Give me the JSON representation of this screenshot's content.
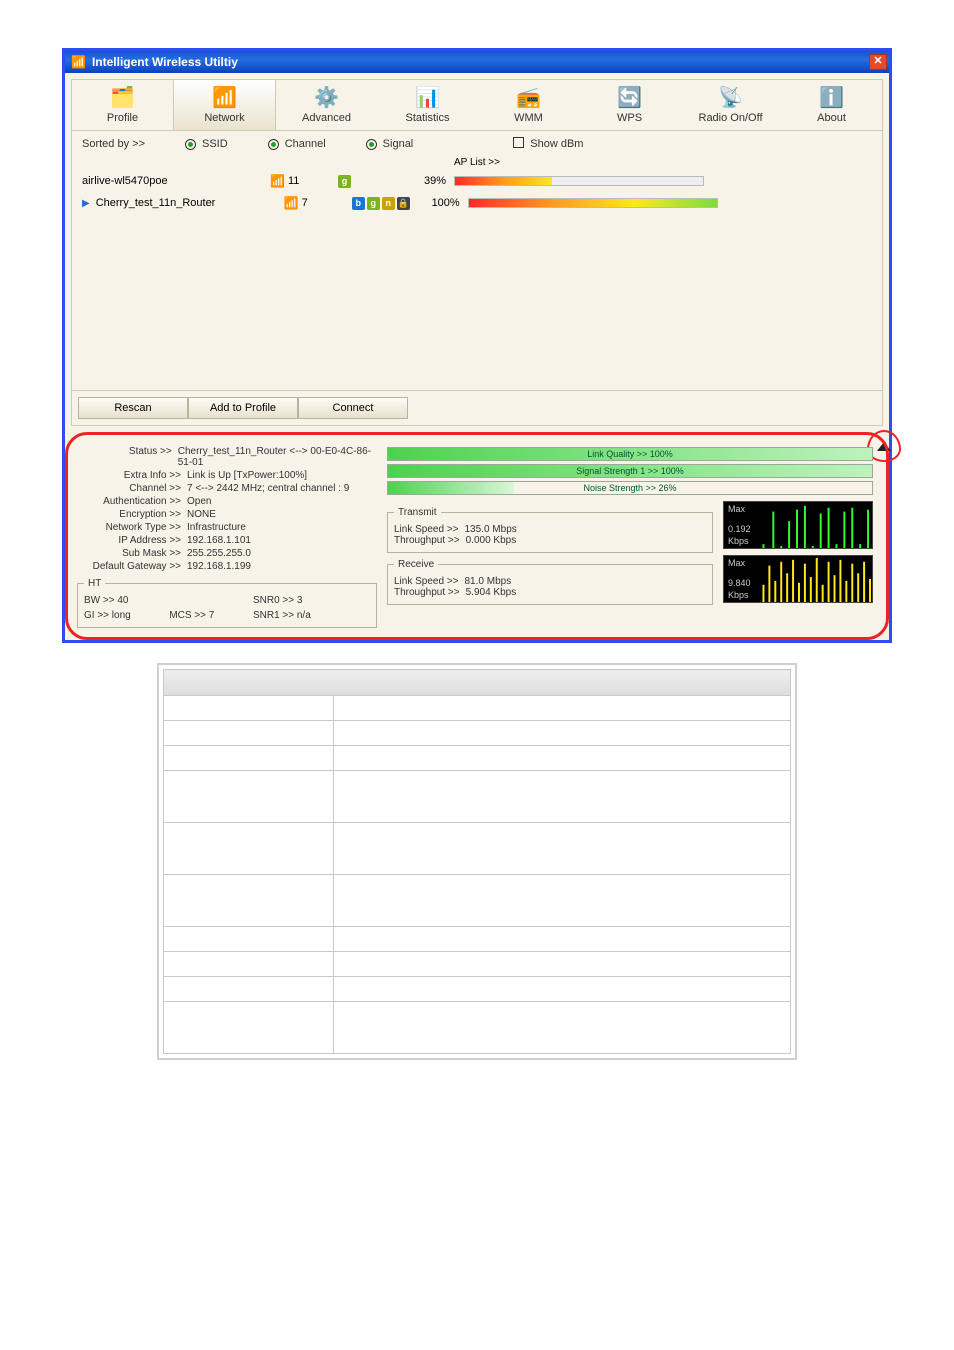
{
  "window": {
    "title": "Intelligent Wireless Utiltiy"
  },
  "toolbar": {
    "items": [
      {
        "label": "Profile"
      },
      {
        "label": "Network"
      },
      {
        "label": "Advanced"
      },
      {
        "label": "Statistics"
      },
      {
        "label": "WMM"
      },
      {
        "label": "WPS"
      },
      {
        "label": "Radio On/Off"
      },
      {
        "label": "About"
      }
    ]
  },
  "filter": {
    "sorted_by": "Sorted by >>",
    "ssid": "SSID",
    "channel": "Channel",
    "signal": "Signal",
    "show_dbm": "Show dBm",
    "ap_list": "AP List >>"
  },
  "ap_list": [
    {
      "ssid": "airlive-wl5470poe",
      "channel": "11",
      "modes": [
        "g"
      ],
      "signal_pct": "39%",
      "signal_val": 39
    },
    {
      "ssid": "Cherry_test_11n_Router",
      "channel": "7",
      "modes": [
        "b",
        "g",
        "n",
        "lock"
      ],
      "signal_pct": "100%",
      "signal_val": 100,
      "selected": true
    }
  ],
  "buttons": {
    "rescan": "Rescan",
    "add_profile": "Add to Profile",
    "connect": "Connect"
  },
  "status_labels": {
    "status": "Status >>",
    "extra": "Extra Info >>",
    "channel": "Channel >>",
    "auth": "Authentication >>",
    "enc": "Encryption >>",
    "nettype": "Network Type >>",
    "ip": "IP Address >>",
    "mask": "Sub Mask >>",
    "gw": "Default Gateway >>"
  },
  "status_values": {
    "status": "Cherry_test_11n_Router <--> 00-E0-4C-86-51-01",
    "extra": "Link is Up [TxPower:100%]",
    "channel": "7 <--> 2442 MHz; central channel : 9",
    "auth": "Open",
    "enc": "NONE",
    "nettype": "Infrastructure",
    "ip": "192.168.1.101",
    "mask": "255.255.255.0",
    "gw": "192.168.1.199"
  },
  "ht": {
    "legend": "HT",
    "bw_k": "BW >>",
    "bw_v": "40",
    "gi_k": "GI >>",
    "gi_v": "long",
    "mcs_k": "MCS >>",
    "mcs_v": "7",
    "snr0_k": "SNR0 >>",
    "snr0_v": "3",
    "snr1_k": "SNR1 >>",
    "snr1_v": "n/a"
  },
  "quality": {
    "link": "Link Quality >> 100%",
    "strength": "Signal Strength 1 >> 100%",
    "noise": "Noise Strength >> 26%",
    "link_pct": 100,
    "strength_pct": 100,
    "noise_pct": 26
  },
  "transmit": {
    "legend": "Transmit",
    "link_speed_k": "Link Speed >>",
    "link_speed_v": "135.0 Mbps",
    "throughput_k": "Throughput >>",
    "throughput_v": "0.000 Kbps",
    "max": "Max",
    "rate": "0.192",
    "unit": "Kbps"
  },
  "receive": {
    "legend": "Receive",
    "link_speed_k": "Link Speed >>",
    "link_speed_v": "81.0 Mbps",
    "throughput_k": "Throughput >>",
    "throughput_v": "5.904 Kbps",
    "max": "Max",
    "rate": "9.840",
    "unit": "Kbps"
  },
  "doc_table": {
    "rows": [
      [
        "",
        ""
      ],
      [
        "",
        ""
      ],
      [
        "",
        ""
      ],
      [
        "",
        ""
      ],
      [
        "",
        ""
      ],
      [
        "",
        ""
      ],
      [
        "",
        ""
      ],
      [
        "",
        ""
      ],
      [
        "",
        ""
      ],
      [
        "",
        ""
      ]
    ]
  }
}
